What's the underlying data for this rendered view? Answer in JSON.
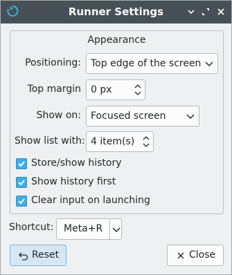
{
  "window": {
    "title": "Runner Settings",
    "icon": "runner-app-icon",
    "buttons": [
      "minimize",
      "maximize",
      "close"
    ]
  },
  "appearance": {
    "title": "Appearance",
    "positioning": {
      "label": "Positioning:",
      "value": "Top edge of the screen"
    },
    "top_margin": {
      "label": "Top margin",
      "value": "0 px"
    },
    "show_on": {
      "label": "Show on:",
      "value": "Focused screen"
    },
    "show_list_with": {
      "label": "Show list with:",
      "value": "4 item(s)"
    },
    "checkboxes": [
      {
        "label": "Store/show history",
        "checked": true
      },
      {
        "label": "Show history first",
        "checked": true
      },
      {
        "label": "Clear input on launching",
        "checked": true
      }
    ]
  },
  "shortcut": {
    "label": "Shortcut:",
    "value": "Meta+R"
  },
  "buttons": {
    "reset": "Reset",
    "close": "Close"
  },
  "colors": {
    "titlebar": "#475057",
    "accent": "#3daee9",
    "background": "#eff0f1"
  }
}
